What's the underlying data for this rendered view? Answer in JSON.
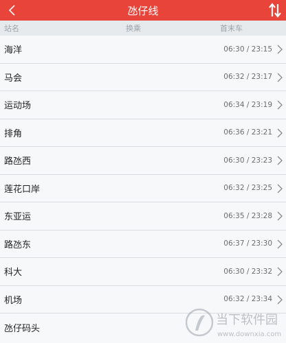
{
  "header": {
    "title": "氹仔线"
  },
  "columns": {
    "station": "站名",
    "transfer": "换乘",
    "first_last": "首末车"
  },
  "stations": [
    {
      "name": "海洋",
      "times": "06:30 / 23:15"
    },
    {
      "name": "马会",
      "times": "06:32 / 23:17"
    },
    {
      "name": "运动场",
      "times": "06:34 / 23:19"
    },
    {
      "name": "排角",
      "times": "06:36 / 23:21"
    },
    {
      "name": "路氹西",
      "times": "06:30 / 23:23"
    },
    {
      "name": "莲花口岸",
      "times": "06:32 / 23:25"
    },
    {
      "name": "东亚运",
      "times": "06:35 / 23:28"
    },
    {
      "name": "路氹东",
      "times": "06:37 / 23:30"
    },
    {
      "name": "科大",
      "times": "06:30 / 23:32"
    },
    {
      "name": "机场",
      "times": "06:32 / 23:34"
    },
    {
      "name": "氹仔码头",
      "times": ""
    }
  ],
  "watermark": {
    "brand": "当下软件园",
    "url": "www.downxia.com"
  },
  "colors": {
    "accent": "#e8443a",
    "header_row": "#e6eaed",
    "background": "#f7f8f9"
  },
  "icons": {
    "back": "back-arrow-icon",
    "swap": "swap-direction-icon",
    "chevron": "chevron-right-icon"
  }
}
